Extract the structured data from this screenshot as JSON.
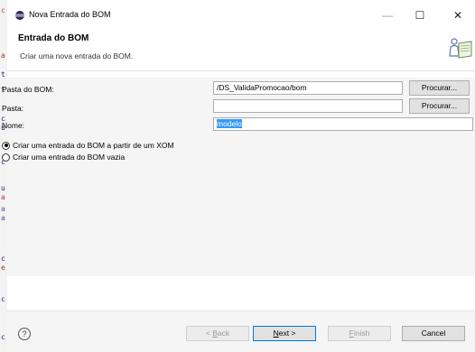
{
  "window": {
    "title": "Nova Entrada do BOM",
    "min_glyph": "—",
    "max_glyph": "☐",
    "close_glyph": "✕"
  },
  "banner": {
    "title": "Entrada do BOM",
    "description": "Criar uma nova entrada do BOM.",
    "icon": "wizard-person-book-icon"
  },
  "form": {
    "bom_folder": {
      "label": "Pasta do BOM:",
      "value": "/DS_ValidaPromocao/bom",
      "browse_label": "Procurar..."
    },
    "folder": {
      "label": "Pasta:",
      "value": "",
      "browse_label": "Procurar..."
    },
    "name": {
      "label": "Nome:",
      "value": "modelo"
    }
  },
  "options": [
    {
      "label": "Criar uma entrada do BOM a partir de um XOM",
      "selected": true
    },
    {
      "label": "Criar uma entrada do BOM vazia",
      "selected": false
    }
  ],
  "footer": {
    "help_glyph": "?",
    "back_label": "< Back",
    "next_label": "Next >",
    "finish_label": "Finish",
    "cancel_label": "Cancel"
  },
  "background_chars": [
    "c",
    "a",
    "t",
    "t",
    "c",
    "u",
    "c",
    "u",
    "a",
    "a",
    "a",
    "c",
    "e",
    "c",
    "c"
  ],
  "colors": {
    "selection": "#3399ff",
    "default_button_border": "#0078d7"
  }
}
